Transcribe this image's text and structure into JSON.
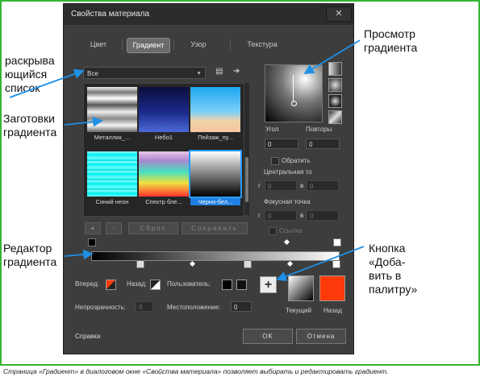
{
  "dialog": {
    "title": "Свойства материала",
    "close_label": "✕",
    "tabs": [
      "Цвет",
      "Градиент",
      "Узор",
      "Текстура"
    ],
    "active_tab": "Градиент",
    "dropdown_value": "Все",
    "presets": [
      {
        "label": "Металлик_...",
        "style": "linear-gradient(to bottom,#eee 0%,#777 12%,#fff 25%,#555 40%,#eee 55%,#888 70%,#f4f4f4 85%,#666 100%)"
      },
      {
        "label": "Небо1",
        "style": "linear-gradient(to bottom,#0a0d3a 0%,#1a2a8a 55%,#4b6ad8 100%)"
      },
      {
        "label": "Пейзаж_пу...",
        "style": "linear-gradient(to bottom,#1da6f0 0%,#7cd0f7 55%,#f0d2a8 75%,#f6c7a0 100%)"
      },
      {
        "label": "Синий неон",
        "style": "repeating-linear-gradient(to bottom,#9ff 0px,#0ee 4px,#6ff 8px,#0dd 12px)"
      },
      {
        "label": "Спектр бле...",
        "style": "linear-gradient(to bottom,#e8c8e8 0%,#aa88cc 20%,#44e0c0 45%,#f0e040 70%,#ff3030 100%)"
      },
      {
        "label": "Черно-бел...",
        "style": "linear-gradient(to bottom,#fff 0%,#000 100%)"
      }
    ],
    "buttons": {
      "add": "+",
      "remove": "-",
      "reset": "Сброс",
      "save": "Сохранить",
      "ok": "OK",
      "cancel": "Отмена",
      "help": "Справка",
      "add_to_palette": "+"
    },
    "angle_label": "Угол",
    "angle_value": "0",
    "repeats_label": "Повторы",
    "repeats_value": "0",
    "invert_label": "Обратить",
    "center_label": "Центральная то",
    "focus_label": "Фокусная точка",
    "g_label": "г",
    "v_label": "в",
    "zero": "0",
    "link_label": "Ссылка",
    "forward_label": "Вперед:",
    "back_label": "Назад:",
    "custom_label": "Пользователь:",
    "opacity_label": "Непрозрачность:",
    "opacity_value": "0",
    "location_label": "Местоположение:",
    "location_value": "0",
    "current_label": "Текущий",
    "back_swatch_label": "Назад",
    "back_color": "#ff3a0a"
  },
  "annotations": {
    "dropdown": "раскрыва\nющийся\nсписок",
    "presets": "Заготовки\nградиента",
    "editor": "Редактор\nградиента",
    "preview": "Просмотр\nградиента",
    "add_button": "Кнопка\n«Доба-\nвить в\nпалитру»"
  },
  "caption": "Страница «Градиент» в диалоговом окне «Свойства материала» позволяет выбирать и редактировать градиент."
}
